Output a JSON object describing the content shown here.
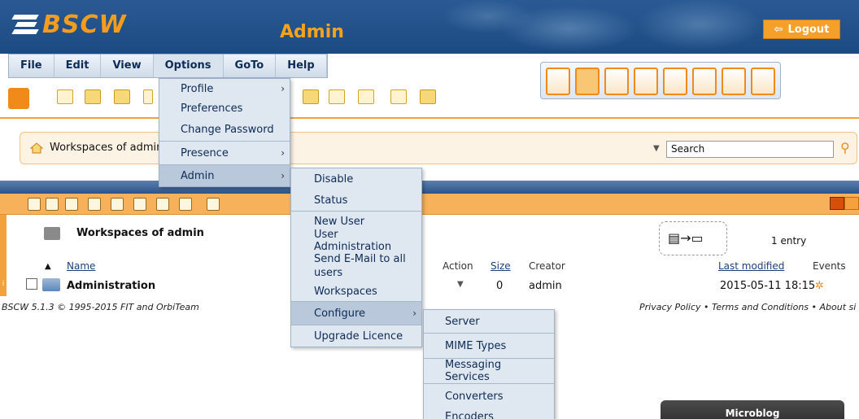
{
  "header": {
    "logo_text": "BSCW",
    "title": "Admin",
    "logout_label": "Logout"
  },
  "menubar": {
    "items": [
      "File",
      "Edit",
      "View",
      "Options",
      "GoTo",
      "Help"
    ]
  },
  "location": {
    "text": "Workspaces of admin",
    "search_value": "Search"
  },
  "folder": {
    "title": "Workspaces of admin",
    "entry_count": "1 entry"
  },
  "table": {
    "headers": {
      "name": "Name",
      "action": "Action",
      "size": "Size",
      "creator": "Creator",
      "last_modified": "Last modified",
      "events": "Events"
    },
    "rows": [
      {
        "name": "Administration",
        "size": "0",
        "creator": "admin",
        "last_modified": "2015-05-11 18:15"
      }
    ]
  },
  "footer": {
    "left": "BSCW 5.1.3 © 1995-2015 FIT and OrbiTeam",
    "right": "Privacy Policy  •  Terms and Conditions  •  About si"
  },
  "options_menu": {
    "items": [
      "Profile",
      "Preferences",
      "Change Password",
      "Presence",
      "Admin"
    ]
  },
  "admin_menu": {
    "items": [
      "Disable",
      "Status",
      "New User",
      "User Administration",
      "Send E-Mail to all users",
      "Workspaces",
      "Configure",
      "Upgrade Licence"
    ]
  },
  "configure_menu": {
    "items": [
      "Server",
      "MIME Types",
      "Messaging Services",
      "Converters",
      "Encoders"
    ]
  },
  "microblog": {
    "title": "Microblog"
  },
  "colors": {
    "header_blue": "#1f4e87",
    "accent_orange": "#f39c1e",
    "menu_bg": "#dfe7f0"
  }
}
